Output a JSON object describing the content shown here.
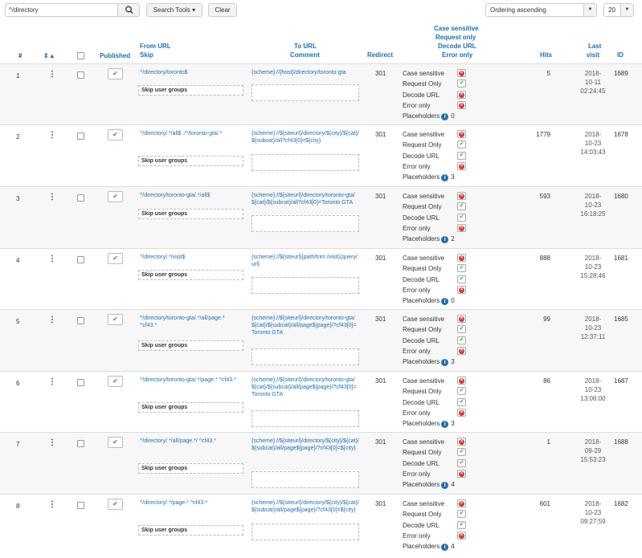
{
  "toolbar": {
    "search_value": "^/directory",
    "search_tools_label": "Search Tools ▾",
    "clear_label": "Clear",
    "ordering_value": "Ordering ascending",
    "limit_value": "20"
  },
  "columns": {
    "num": "#",
    "published": "Published",
    "from_url": "From URL",
    "skip": "Skip",
    "to_url": "To URL",
    "comment": "Comment",
    "redirect": "Redirect",
    "flags1": "Case sensitive",
    "flags2": "Request only",
    "flags3": "Decode URL",
    "flags4": "Error only",
    "hits": "Hits",
    "last_visit1": "Last",
    "last_visit2": "visit",
    "id": "ID"
  },
  "flag_labels": [
    "Case sensitive",
    "Request Only",
    "Decode URL",
    "Error only",
    "Placeholders"
  ],
  "skip_label": "Skip user groups",
  "rows": [
    {
      "num": "1",
      "from": "^/directory/toronto$",
      "to": "{scheme}://{host}/directory/toronto-gta",
      "redirect": "301",
      "flags": [
        "no",
        "ok",
        "no",
        "no"
      ],
      "placeholders": "0",
      "hits": "5",
      "visit": [
        "2018-",
        "10-11",
        "02:24:45"
      ],
      "id": "1689"
    },
    {
      "num": "2",
      "from": "^/directory/.*/all$ ./*/toronto-gta/.*",
      "to": "{scheme}://${siteurl}/directory/${city}/${cat}/${subcat}/all?cf43[0]=${city}",
      "redirect": "301",
      "flags": [
        "no",
        "ok",
        "ok",
        "no"
      ],
      "placeholders": "3",
      "hits": "1779",
      "visit": [
        "2018-",
        "10-23",
        "14:03:43"
      ],
      "id": "1678"
    },
    {
      "num": "3",
      "from": "^/directory/toronto-gta/.*/all$",
      "to": "{scheme}://${siteurl}/directory/toronto-gta/${cat}/${subcat}/all?cf43[0]=Toronto GTA",
      "redirect": "301",
      "flags": [
        "no",
        "ok",
        "ok",
        "no"
      ],
      "placeholders": "2",
      "hits": "593",
      "visit": [
        "2018-",
        "10-23",
        "16:18:25"
      ],
      "id": "1680"
    },
    {
      "num": "4",
      "from": "^/directory/.*/visit$",
      "to": "{scheme}://${siteurl}{path/trim /visit}{query/url}",
      "redirect": "301",
      "flags": [
        "no",
        "ok",
        "ok",
        "no"
      ],
      "placeholders": "0",
      "hits": "888",
      "visit": [
        "2018-",
        "10-23",
        "15:28:46"
      ],
      "id": "1681"
    },
    {
      "num": "5",
      "from": "^/directory/toronto-gta/.*/all/page.* ^cf43.*",
      "to": "{scheme}://${siteurl}/directory/toronto-gta/${cat}/${subcat}/all/page${page}/?cf43[0]=Toronto GTA",
      "redirect": "301",
      "flags": [
        "no",
        "ok",
        "ok",
        "no"
      ],
      "placeholders": "3",
      "hits": "99",
      "visit": [
        "2018-",
        "10-23",
        "12:37:11"
      ],
      "id": "1685"
    },
    {
      "num": "6",
      "from": "^/directory/toronto-gta/.*/page.* ^cf43.*",
      "to": "{scheme}://${siteurl}/directory/toronto-gta/${cat}/${subcat}/all/page${page}/?cf43[0]=Toronto GTA",
      "redirect": "301",
      "flags": [
        "no",
        "ok",
        "ok",
        "no"
      ],
      "placeholders": "3",
      "hits": "86",
      "visit": [
        "2018-",
        "10-23",
        "13:06:00"
      ],
      "id": "1687"
    },
    {
      "num": "7",
      "from": "^/directory/.*/all/page.*/ ^cf43.*",
      "to": "{scheme}://${siteurl}/directory/${city}/${cat}/${subcat}/all/page${page}/?cf43[0]=${city}",
      "redirect": "301",
      "flags": [
        "no",
        "ok",
        "ok",
        "no"
      ],
      "placeholders": "4",
      "hits": "1",
      "visit": [
        "2018-",
        "09-29",
        "15:53:23"
      ],
      "id": "1688"
    },
    {
      "num": "8",
      "from": "^/directory/.*/page.* ^cf43.*",
      "to": "{scheme}://${siteurl}/directory/${city}/${cat}/${subcat}/all/page${page}/?cf43[0]=${city}",
      "redirect": "301",
      "flags": [
        "no",
        "ok",
        "ok",
        "no"
      ],
      "placeholders": "4",
      "hits": "601",
      "visit": [
        "2018-",
        "10-23",
        "09:27:59"
      ],
      "id": "1682"
    }
  ]
}
